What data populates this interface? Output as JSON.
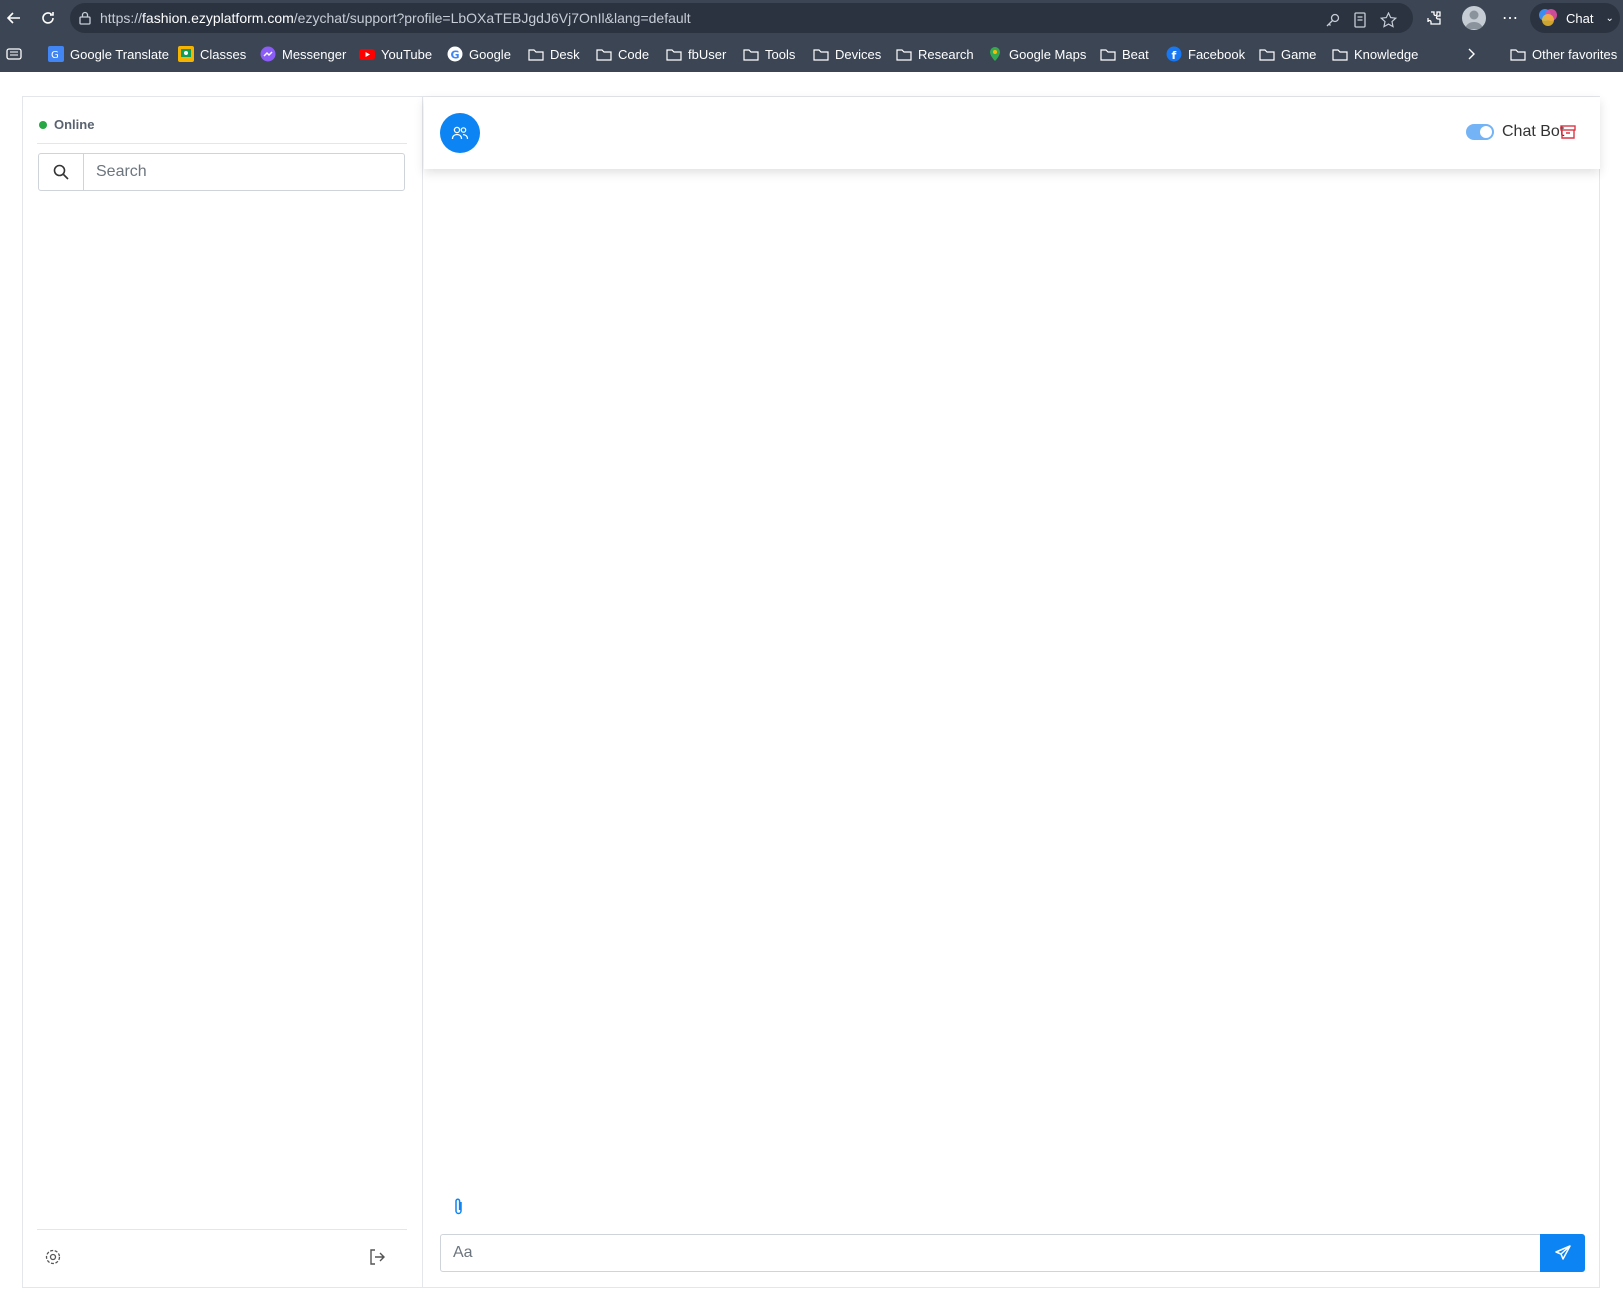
{
  "browser": {
    "url_scheme": "https://",
    "url_host": "fashion.ezyplatform.com",
    "url_path": "/ezychat/support?profile=LbOXaTEBJgdJ6Vj7OnIl&lang=default",
    "chat_label": "Chat",
    "bookmarks": [
      {
        "label": "Google Translate",
        "icon": "google-translate-icon"
      },
      {
        "label": "Classes",
        "icon": "classroom-icon"
      },
      {
        "label": "Messenger",
        "icon": "messenger-icon"
      },
      {
        "label": "YouTube",
        "icon": "youtube-icon"
      },
      {
        "label": "Google",
        "icon": "google-icon"
      },
      {
        "label": "Desk",
        "icon": "folder-icon"
      },
      {
        "label": "Code",
        "icon": "folder-icon"
      },
      {
        "label": "fbUser",
        "icon": "folder-icon"
      },
      {
        "label": "Tools",
        "icon": "folder-icon"
      },
      {
        "label": "Devices",
        "icon": "folder-icon"
      },
      {
        "label": "Research",
        "icon": "folder-icon"
      },
      {
        "label": "Google Maps",
        "icon": "google-maps-icon"
      },
      {
        "label": "Beat",
        "icon": "folder-icon"
      },
      {
        "label": "Facebook",
        "icon": "facebook-icon"
      },
      {
        "label": "Game",
        "icon": "folder-icon"
      },
      {
        "label": "Knowledge",
        "icon": "folder-icon"
      }
    ],
    "other_favorites": "Other favorites"
  },
  "sidebar": {
    "status_label": "Online",
    "status_color": "#28a745",
    "search_placeholder": "Search"
  },
  "main": {
    "chat_bot_label": "Chat Bot",
    "chat_bot_enabled": true,
    "composer_placeholder": "Aa"
  },
  "colors": {
    "accent": "#0d84f3",
    "archive": "#dc3545",
    "browser_chrome": "#3b4554"
  }
}
